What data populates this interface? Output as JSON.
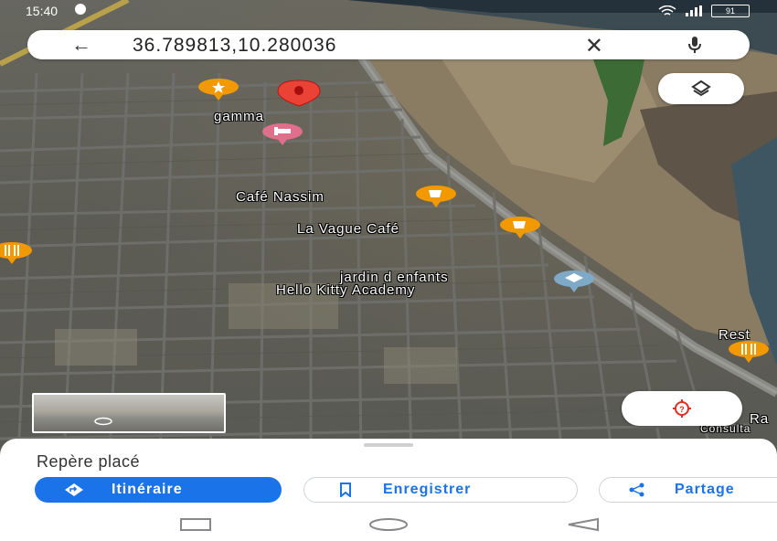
{
  "status_bar": {
    "time": "15:40",
    "battery": "91"
  },
  "search": {
    "query": "36.789813,10.280036",
    "back_icon": "arrow-left-icon",
    "clear_icon": "close-icon",
    "mic_icon": "mic-icon"
  },
  "map": {
    "pois": [
      {
        "label": "gamma",
        "icon": "star-pin-icon"
      },
      {
        "label": "Café Nassim",
        "icon": "cafe-pin-icon"
      },
      {
        "label": "La Vague Café",
        "icon": "cafe-pin-icon"
      },
      {
        "label": "jardin d enfants",
        "icon": "school-pin-icon"
      },
      {
        "label": "Hello Kitty Academy",
        "icon": "school-pin-icon"
      },
      {
        "label": "Rest",
        "icon": "restaurant-pin-icon"
      },
      {
        "label": "Ra",
        "icon": ""
      },
      {
        "label": "Consulta",
        "icon": ""
      }
    ],
    "dropped_pin_icon": "red-pin-icon",
    "hotel_icon": "hotel-pin-icon"
  },
  "controls": {
    "layers_icon": "layers-icon",
    "locate_icon": "crosshair-icon",
    "street_view_icon": "360-icon"
  },
  "sheet": {
    "title": "Repère placé",
    "actions": [
      {
        "label": "Itinéraire",
        "icon": "directions-icon"
      },
      {
        "label": "Enregistrer",
        "icon": "bookmark-icon"
      },
      {
        "label": "Partage",
        "icon": "share-icon"
      }
    ]
  },
  "colors": {
    "accent": "#1a73e8",
    "pin_red": "#ea4335",
    "poi_orange": "#f29900",
    "poi_pink": "#e06f8b",
    "poi_blue": "#7ea9c7"
  }
}
